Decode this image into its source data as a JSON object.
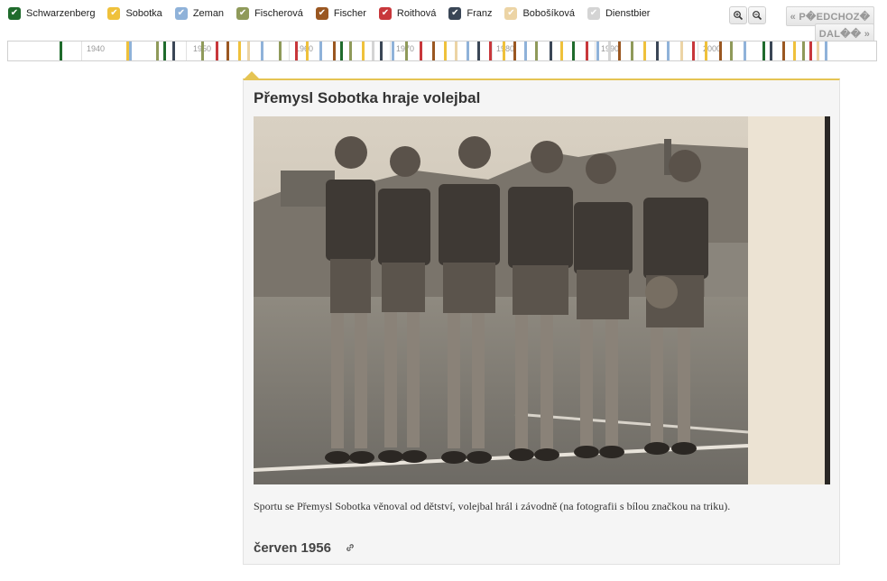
{
  "legend": [
    {
      "label": "Schwarzenberg",
      "color": "#1f6b2c"
    },
    {
      "label": "Sobotka",
      "color": "#efc13b"
    },
    {
      "label": "Zeman",
      "color": "#8fb2d9"
    },
    {
      "label": "Fischerová",
      "color": "#8f9a5a"
    },
    {
      "label": "Fischer",
      "color": "#9a5721"
    },
    {
      "label": "Roithová",
      "color": "#c8373b"
    },
    {
      "label": "Franz",
      "color": "#3a4656"
    },
    {
      "label": "Bobošíková",
      "color": "#ecd4a5"
    },
    {
      "label": "Dienstbier",
      "color": "#d4d4d4"
    }
  ],
  "nav": {
    "prev": "« P�EDCHOZ�",
    "next": "DAL�� »"
  },
  "zoom": {
    "in_icon": "zoom-in-icon",
    "out_icon": "zoom-out-icon"
  },
  "timeline": {
    "labels": [
      "1940",
      "1950",
      "1960",
      "1970",
      "1980",
      "1990",
      "2000"
    ]
  },
  "card": {
    "title": "Přemysl Sobotka hraje volejbal",
    "caption": "Sportu se Přemysl Sobotka věnoval od dětství, volejbal hrál i závodně (na fotografii s bílou značkou na triku).",
    "date": "červen 1956"
  },
  "colors": {
    "accent": "#e5c453"
  }
}
